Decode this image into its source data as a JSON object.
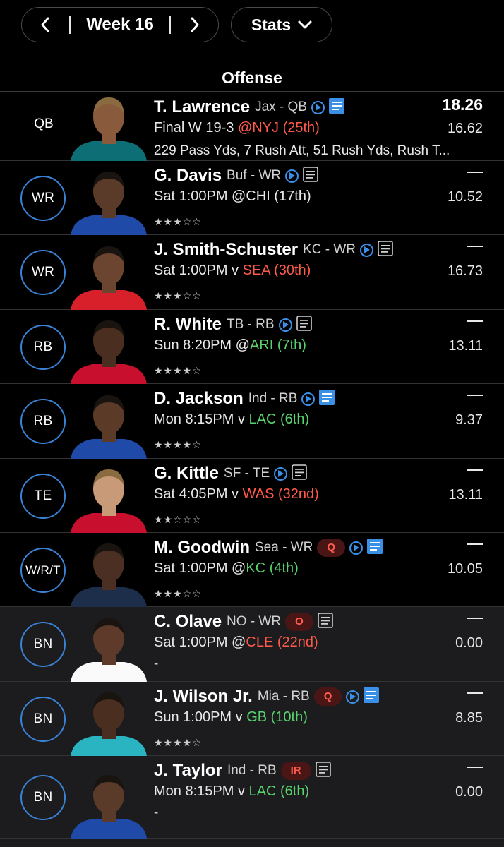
{
  "week_nav": {
    "label": "Week 16"
  },
  "stats_menu": {
    "label": "Stats"
  },
  "section": {
    "title": "Offense"
  },
  "colors": {
    "accent": "#3a82d6",
    "opp_bad": "#ff5a4a",
    "opp_good": "#58d26c",
    "badge_text": "#ff5c4d"
  },
  "players": [
    {
      "slot": "QB",
      "name": "T. Lawrence",
      "team": "Jax - QB",
      "news_highlight": true,
      "score": "18.26",
      "proj": "16.62",
      "game_pre": "Final W 19-3 ",
      "opp": "@NYJ (25th)",
      "opp_color": "red",
      "detail": "229 Pass Yds, 7 Rush Att, 51 Rush Yds, Rush T..."
    },
    {
      "slot": "WR",
      "name": "G. Davis",
      "team": "Buf - WR",
      "news_highlight": false,
      "score": "—",
      "proj": "10.52",
      "game_pre": "Sat 1:00PM @CHI (17th)",
      "opp": "",
      "opp_color": "",
      "stars": "★★★☆☆"
    },
    {
      "slot": "WR",
      "name": "J. Smith-Schuster",
      "team": "KC - WR",
      "news_highlight": false,
      "score": "—",
      "proj": "16.73",
      "game_pre": "Sat 1:00PM v ",
      "opp": "SEA (30th)",
      "opp_color": "red",
      "stars": "★★★☆☆"
    },
    {
      "slot": "RB",
      "name": "R. White",
      "team": "TB - RB",
      "news_highlight": false,
      "score": "—",
      "proj": "13.11",
      "game_pre": "Sun 8:20PM @",
      "opp": "ARI (7th)",
      "opp_color": "green",
      "stars": "★★★★☆"
    },
    {
      "slot": "RB",
      "name": "D. Jackson",
      "team": "Ind - RB",
      "news_highlight": true,
      "score": "—",
      "proj": "9.37",
      "game_pre": "Mon 8:15PM v ",
      "opp": "LAC (6th)",
      "opp_color": "green",
      "stars": "★★★★☆"
    },
    {
      "slot": "TE",
      "name": "G. Kittle",
      "team": "SF - TE",
      "news_highlight": false,
      "score": "—",
      "proj": "13.11",
      "game_pre": "Sat 4:05PM v ",
      "opp": "WAS (32nd)",
      "opp_color": "red",
      "stars": "★★☆☆☆"
    },
    {
      "slot": "W/R/T",
      "name": "M. Goodwin",
      "team": "Sea - WR",
      "badge": "Q",
      "news_highlight": true,
      "score": "—",
      "proj": "10.05",
      "game_pre": "Sat 1:00PM @",
      "opp": "KC (4th)",
      "opp_color": "green",
      "stars": "★★★☆☆"
    },
    {
      "slot": "BN",
      "name": "C. Olave",
      "team": "NO - WR",
      "badge": "O",
      "no_play": true,
      "news_highlight": false,
      "score": "—",
      "proj": "0.00",
      "game_pre": "Sat 1:00PM @",
      "opp": "CLE (22nd)",
      "opp_color": "red",
      "dash": "-"
    },
    {
      "slot": "BN",
      "name": "J. Wilson Jr.",
      "team": "Mia - RB",
      "badge": "Q",
      "news_highlight": true,
      "score": "—",
      "proj": "8.85",
      "game_pre": "Sun 1:00PM v ",
      "opp": "GB (10th)",
      "opp_color": "green",
      "stars": "★★★★☆"
    },
    {
      "slot": "BN",
      "name": "J. Taylor",
      "team": "Ind - RB",
      "badge": "IR",
      "no_play": true,
      "news_highlight": false,
      "score": "—",
      "proj": "0.00",
      "game_pre": "Mon 8:15PM v ",
      "opp": "LAC (6th)",
      "opp_color": "green",
      "dash": "-"
    }
  ]
}
